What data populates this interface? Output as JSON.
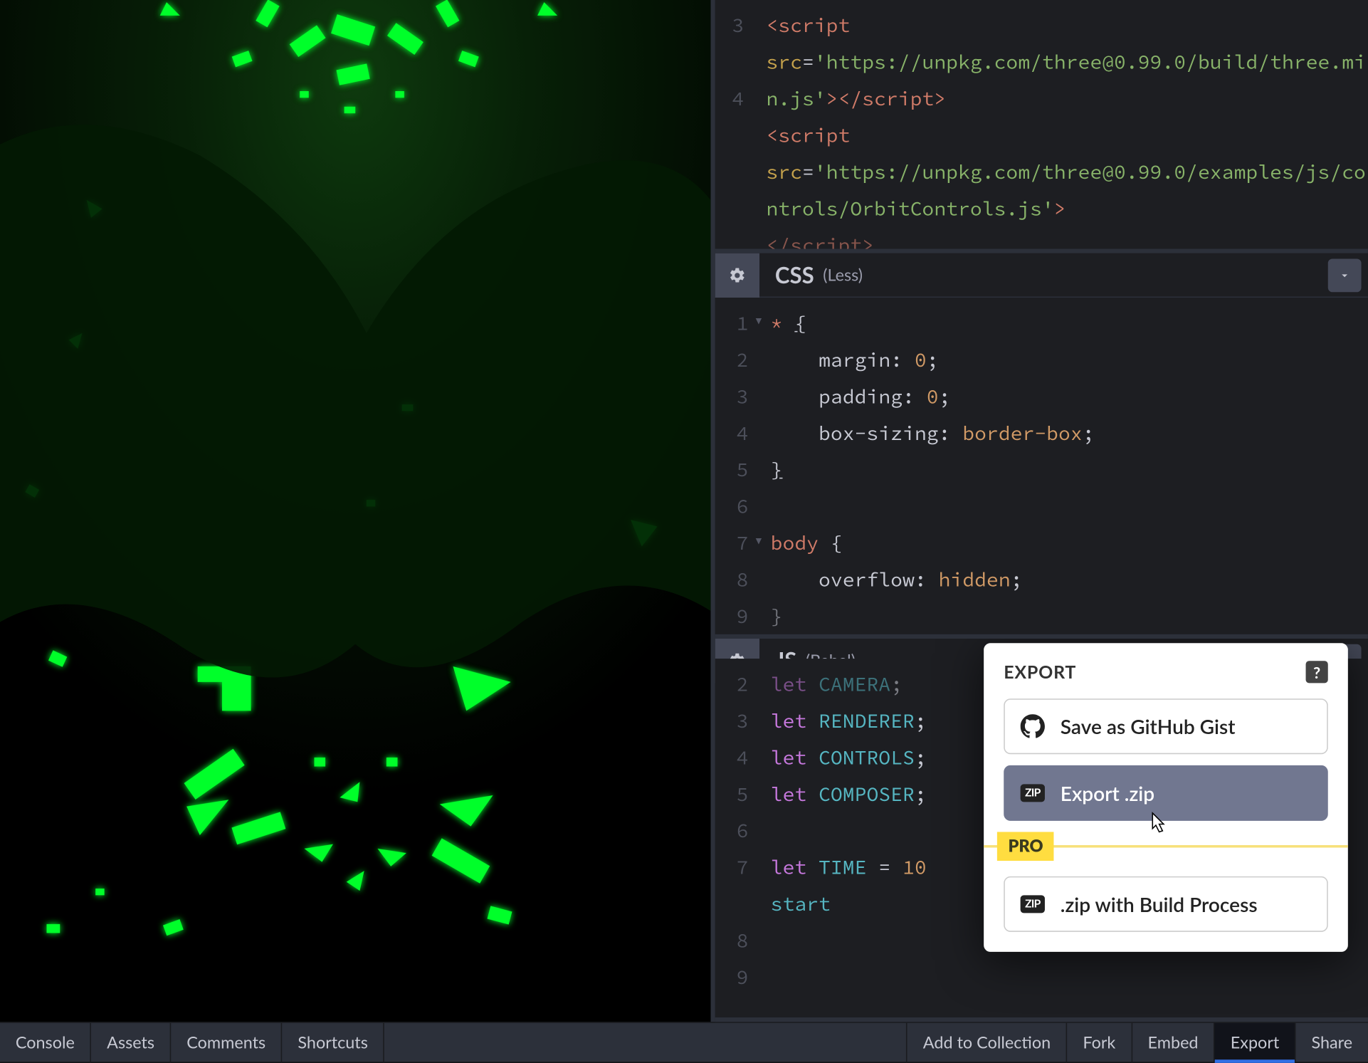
{
  "panels": {
    "html": {
      "line_start": 3,
      "lines": [
        {
          "n": 3,
          "html": "<span class='tok-tag'>&lt;script</span>"
        },
        {
          "n": "",
          "html": "<span class='tok-attr'>src</span><span class='tok-op'>=</span><span class='tok-str'>'https://unpkg.com/three@0.99.0/build/three.min.js'</span><span class='tok-tag'>&gt;&lt;/script&gt;</span>"
        },
        {
          "n": 4,
          "html": "<span class='tok-tag'>&lt;script</span>"
        },
        {
          "n": "",
          "html": "<span class='tok-attr'>src</span><span class='tok-op'>=</span><span class='tok-str'>'https://unpkg.com/three@0.99.0/examples/js/controls/OrbitControls.js'</span><span class='tok-tag'>&gt;</span>"
        },
        {
          "n": "",
          "html": "<span class='tok-tag' style='opacity:.6'>&lt;/script&gt;</span>"
        }
      ]
    },
    "css": {
      "title": "CSS",
      "subtitle": "(Less)",
      "lines": [
        {
          "n": 1,
          "fold": true,
          "html": "<span class='tok-sel'>*</span> <span class='brace-u'>{</span>"
        },
        {
          "n": 2,
          "html": "    <span class='tok-prop'>margin</span>: <span class='tok-num'>0</span>;"
        },
        {
          "n": 3,
          "html": "    <span class='tok-prop'>padding</span>: <span class='tok-num'>0</span>;"
        },
        {
          "n": 4,
          "html": "    <span class='tok-prop'>box-sizing</span>: <span class='tok-val'>border-box</span>;"
        },
        {
          "n": 5,
          "html": "<span class='brace-u'>}</span>"
        },
        {
          "n": 6,
          "html": " "
        },
        {
          "n": 7,
          "fold": true,
          "html": "<span class='tok-sel'>body</span> {"
        },
        {
          "n": 8,
          "html": "    <span class='tok-prop'>overflow</span>: <span class='tok-val'>hidden</span>;"
        },
        {
          "n": 9,
          "html": "<span style='opacity:.5'>}</span>",
          "clipped": true
        }
      ]
    },
    "js": {
      "title": "JS",
      "subtitle": "(Babel)",
      "lines": [
        {
          "n": 2,
          "html": "<span class='tok-kw' style='opacity:.55'>let</span> <span class='tok-var' style='opacity:.55'>CAMERA</span><span style='opacity:.55'>;</span>",
          "clipped_top": true
        },
        {
          "n": 3,
          "html": "<span class='tok-kw'>let</span> <span class='tok-var'>RENDERER</span>;"
        },
        {
          "n": 4,
          "html": "<span class='tok-kw'>let</span> <span class='tok-var'>CONTROLS</span>;"
        },
        {
          "n": 5,
          "html": "<span class='tok-kw'>let</span> <span class='tok-var'>COMPOSER</span>;"
        },
        {
          "n": 6,
          "html": " "
        },
        {
          "n": 7,
          "html": "<span class='tok-kw'>let</span> <span class='tok-var'>TIME</span> <span class='tok-op'>=</span> <span class='tok-num'>10</span><span class='tok-op'></span>"
        },
        {
          "n": "",
          "html": "<span class='tok-var'>start</span>"
        },
        {
          "n": 8,
          "html": " "
        },
        {
          "n": 9,
          "html": " "
        }
      ]
    }
  },
  "export_popover": {
    "title": "EXPORT",
    "buttons": {
      "gist": "Save as GitHub Gist",
      "zip": "Export .zip",
      "zip_build": ".zip with Build Process"
    },
    "pro_label": "PRO",
    "zip_badge": "ZIP"
  },
  "bottom_bar": {
    "left": [
      "Console",
      "Assets",
      "Comments",
      "Shortcuts"
    ],
    "right": [
      "Add to Collection",
      "Fork",
      "Embed",
      "Export",
      "Share"
    ],
    "active_right": "Export"
  }
}
